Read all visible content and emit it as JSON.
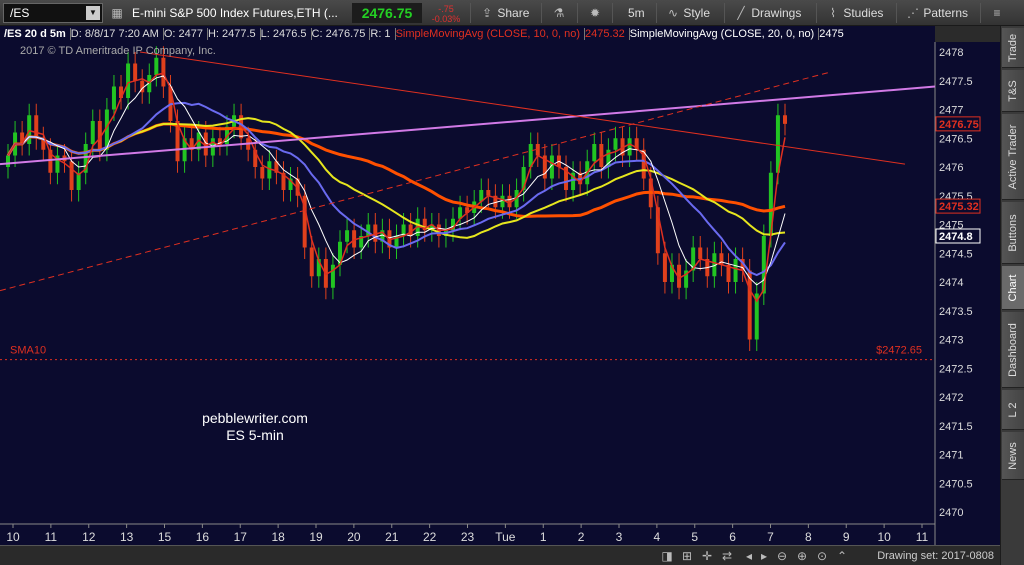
{
  "toolbar": {
    "symbol": "/ES",
    "description": "E-mini S&P 500 Index Futures,ETH (...",
    "last_price": "2476.75",
    "change_abs": "-.75",
    "change_pct": "-0.03%",
    "share_label": "Share",
    "timeframe_label": "5m",
    "style_label": "Style",
    "drawings_label": "Drawings",
    "studies_label": "Studies",
    "patterns_label": "Patterns"
  },
  "infobar": {
    "chart_id": "/ES 20 d 5m",
    "date": "D: 8/8/17 7:20 AM",
    "open": "O: 2477",
    "high": "H: 2477.5",
    "low": "L: 2476.5",
    "close": "C: 2476.75",
    "r": "R: 1",
    "sma1_label": "SimpleMovingAvg (CLOSE, 10, 0, no)",
    "sma1_value": "2475.32",
    "sma2_label": "SimpleMovingAvg (CLOSE, 20, 0, no)",
    "sma2_value": "2475"
  },
  "copyright": "2017 © TD Ameritrade IP Company, Inc.",
  "watermark": {
    "line1": "pebblewriter.com",
    "line2": "ES 5-min"
  },
  "side_tabs": [
    "Trade",
    "T&S",
    "Active Trader",
    "Buttons",
    "Chart",
    "Dashboard",
    "L 2",
    "News"
  ],
  "active_tab": "Chart",
  "bottom": {
    "drawing_set": "Drawing set: 2017-0808"
  },
  "colors": {
    "background": "#0b0b2e",
    "up": "#22c422",
    "down": "#e0401c",
    "sma10": "#e03020",
    "sma20": "#ffffff",
    "sma_mid": "#6a6af0",
    "sma_yellow": "#e6e61e",
    "sma_long": "#ff5000",
    "magenta_line": "#d27ae6"
  },
  "chart_data": {
    "type": "candlestick",
    "y_range": [
      2470,
      2478
    ],
    "y_ticks": [
      "2478",
      "2477.5",
      "2477",
      "2476.5",
      "2476",
      "2475.5",
      "2475",
      "2474.5",
      "2474",
      "2473.5",
      "2473",
      "2472.5",
      "2472",
      "2471.5",
      "2471",
      "2470.5",
      "2470"
    ],
    "x_ticks": [
      "10",
      "11",
      "12",
      "13",
      "15",
      "16",
      "17",
      "18",
      "19",
      "20",
      "21",
      "22",
      "23",
      "Tue",
      "1",
      "2",
      "3",
      "4",
      "5",
      "6",
      "7",
      "8",
      "9",
      "10",
      "11"
    ],
    "price_labels": [
      {
        "text": "2476.75",
        "value": 2476.75,
        "color": "#e03020"
      },
      {
        "text": "2475.32",
        "value": 2475.32,
        "color": "#e03020"
      },
      {
        "text": "2474.8",
        "value": 2474.8,
        "color": "#ffffff"
      }
    ],
    "sma_line": {
      "label": "SMA10",
      "price_text": "$2472.65",
      "value": 2472.65
    },
    "candles_close": [
      2476.2,
      2476.6,
      2476.4,
      2476.9,
      2476.5,
      2476.3,
      2475.9,
      2476.2,
      2476.1,
      2475.6,
      2475.9,
      2476.4,
      2476.8,
      2476.3,
      2477.0,
      2477.4,
      2477.2,
      2477.8,
      2477.5,
      2477.3,
      2477.6,
      2477.9,
      2477.4,
      2476.8,
      2476.1,
      2476.5,
      2476.3,
      2476.6,
      2476.2,
      2476.5,
      2476.4,
      2476.7,
      2476.9,
      2476.5,
      2476.3,
      2476.0,
      2475.8,
      2476.1,
      2475.9,
      2475.6,
      2475.8,
      2475.5,
      2474.6,
      2474.1,
      2474.4,
      2473.9,
      2474.3,
      2474.7,
      2474.9,
      2474.6,
      2474.8,
      2475.0,
      2474.7,
      2474.9,
      2474.6,
      2474.8,
      2475.0,
      2474.8,
      2475.1,
      2474.9,
      2475.0,
      2474.8,
      2474.9,
      2475.1,
      2475.3,
      2475.2,
      2475.4,
      2475.6,
      2475.5,
      2475.3,
      2475.5,
      2475.3,
      2475.6,
      2476.0,
      2476.4,
      2476.2,
      2475.8,
      2476.2,
      2476.0,
      2475.6,
      2475.9,
      2475.7,
      2476.1,
      2476.4,
      2476.0,
      2476.3,
      2476.5,
      2476.2,
      2476.5,
      2476.3,
      2475.8,
      2475.3,
      2474.5,
      2474.0,
      2474.3,
      2473.9,
      2474.2,
      2474.6,
      2474.4,
      2474.1,
      2474.5,
      2474.3,
      2474.0,
      2474.4,
      2474.2,
      2473.0,
      2473.8,
      2474.8,
      2475.9,
      2476.9,
      2476.75
    ],
    "sma_values": {
      "x_start": "10",
      "x_end": "7",
      "note_value_range": [
        2473.5,
        2477.5
      ]
    }
  }
}
